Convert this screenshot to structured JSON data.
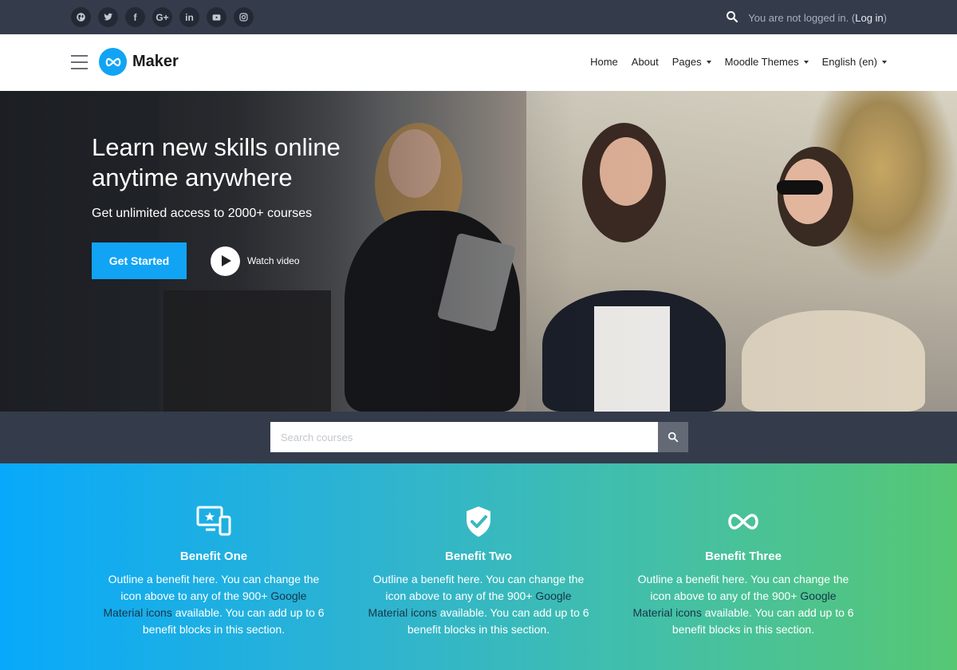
{
  "topbar": {
    "social_icons": [
      "globe-icon",
      "twitter-icon",
      "facebook-icon",
      "google-plus-icon",
      "linkedin-icon",
      "youtube-icon",
      "instagram-icon"
    ],
    "google_plus_label": "G+",
    "linkedin_label": "in",
    "facebook_label": "f",
    "login_text": "You are not logged in.",
    "login_link_open": "(",
    "login_link": "Log in",
    "login_link_close": ")"
  },
  "navbar": {
    "brand": "Maker",
    "menu": [
      {
        "label": "Home"
      },
      {
        "label": "About"
      },
      {
        "label": "Pages"
      },
      {
        "label": "Moodle Themes"
      },
      {
        "label": "English (en)"
      }
    ]
  },
  "hero": {
    "title": "Learn new skills online anytime anywhere",
    "subtitle": "Get unlimited access to 2000+ courses",
    "cta_label": "Get Started",
    "video_label": "Watch video"
  },
  "search": {
    "placeholder": "Search courses"
  },
  "benefits": [
    {
      "title": "Benefit One",
      "text_before": "Outline a benefit here. You can change the icon above to any of the 900+ ",
      "link": "Google Material icons",
      "text_after": " available. You can add up to 6 benefit blocks in this section.",
      "icon": "devices-star-icon"
    },
    {
      "title": "Benefit Two",
      "text_before": "Outline a benefit here. You can change the icon above to any of the 900+ ",
      "link": "Google Material icons",
      "text_after": " available. You can add up to 6 benefit blocks in this section.",
      "icon": "shield-check-icon"
    },
    {
      "title": "Benefit Three",
      "text_before": "Outline a benefit here. You can change the icon above to any of the 900+ ",
      "link": "Google Material icons",
      "text_after": " available. You can add up to 6 benefit blocks in this section.",
      "icon": "infinity-icon"
    }
  ],
  "colors": {
    "accent": "#11a4f5",
    "topbar_bg": "#343c4c",
    "gradient_start": "#08a9fb",
    "gradient_end": "#57c774"
  }
}
